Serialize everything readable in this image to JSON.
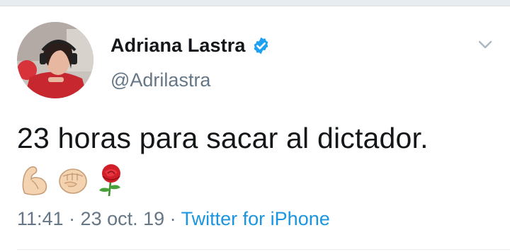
{
  "tweet": {
    "author": {
      "name": "Adriana Lastra",
      "handle": "@Adrilastra",
      "verified": true
    },
    "text": "23 horas para sacar al dictador.",
    "emojis": [
      "flexed-biceps-emoji",
      "raised-fist-emoji",
      "rose-emoji"
    ],
    "timestamp": "11:41 · 23 oct. 19 · ",
    "source": "Twitter for iPhone"
  },
  "colors": {
    "verified_badge": "#1da1f2",
    "source_link": "#1b95e0",
    "secondary_text": "#657786",
    "primary_text": "#14171a"
  }
}
